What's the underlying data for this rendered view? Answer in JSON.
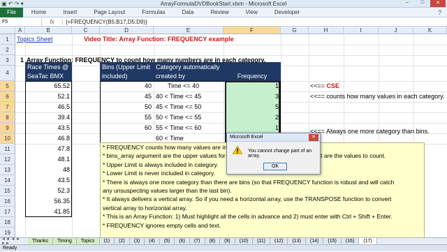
{
  "window": {
    "title": "ArrayFormulaDVDBookStart.xlsm - Microsoft Excel",
    "min": "–",
    "max": "□",
    "close": "✕"
  },
  "ribbon": {
    "file": "File",
    "tabs": [
      "Home",
      "Insert",
      "Page Layout",
      "Formulas",
      "Data",
      "Review",
      "View",
      "Developer"
    ],
    "help": "?"
  },
  "formula_bar": {
    "name_box": "F5",
    "fx": "fx",
    "formula": "{=FREQUENCY(B5:B17,D5:D9)}"
  },
  "columns": [
    "A",
    "B",
    "C",
    "D",
    "E",
    "F",
    "G",
    "H",
    "I",
    "J",
    "K"
  ],
  "rows": [
    "1",
    "2",
    "3",
    "4",
    "5",
    "6",
    "7",
    "8",
    "9",
    "10",
    "11",
    "12",
    "13",
    "14",
    "15",
    "16",
    "17",
    "18",
    "19",
    "20",
    "21",
    "22"
  ],
  "sheet": {
    "link": "Topics Sheet",
    "video_title": "Video Title: Array Function: FREQUENCY example",
    "row3_num": "1",
    "row3_text": "Array Function: FREQUENCY to count how many numbers are in each category.",
    "race_header": [
      "Race Times @",
      "SeaTac BMX"
    ],
    "race_times": [
      "65.52",
      "52.1",
      "46.5",
      "39.4",
      "43.5",
      "46.8",
      "47.8",
      "48.1",
      "48",
      "43.5",
      "52.3",
      "56.35",
      "41.85"
    ],
    "bins_header": [
      "Bins (Upper Limit",
      "included)"
    ],
    "bins": [
      "40",
      "45",
      "50",
      "55",
      "60"
    ],
    "cat_header": [
      "Category automatically",
      "created by FREQUENCY"
    ],
    "categories": [
      "Time <= 40",
      "40 < Time <= 45",
      "45 < Time <= 50",
      "50 < Time <= 55",
      "55 < Time <= 60",
      "60 < Time"
    ],
    "freq_header": "Frequency",
    "frequency": [
      "1",
      "3",
      "5",
      "2",
      "1",
      "1"
    ],
    "note_cse_arrow": "<<==",
    "note_cse": "CSE",
    "note_counts": "<<== counts how many values in each category.",
    "note_always": "<<== Always one more category than bins."
  },
  "notes": [
    "* FREQUENCY counts how many values are in each category.",
    "* bins_array argument are the upper values for each category, data_array argument are the values to count.",
    "* Upper Limit is always included in category.",
    "* Lower Limit is never included in category.",
    "* There is always one more category than there are bins (so that FREQUENCY function is robust and will catch",
    "   any unsuspecting values larger than the last bin).",
    "* It always delivers a vertical array. So if you need a horizontal array, use the TRANSPOSE function to convert",
    "   vertical array to horizontal array.",
    "* This is an Array Function: 1) Must highlight all the cells in advance and 2) must enter with Ctrl + Shift + Enter.",
    "* FREQUENCY ignores empty cells and text."
  ],
  "dialog": {
    "title": "Microsoft Excel",
    "message": "You cannot change part of an array.",
    "ok": "OK",
    "close": "✕"
  },
  "sheet_tabs": {
    "nav": "◄◄ ◄ ► ►►",
    "tabs": [
      "Thanks",
      "Timing",
      "Topics",
      "(1)",
      "(2)",
      "(3)",
      "(4)",
      "(5)",
      "(6)",
      "(7)",
      "(8)",
      "(9)",
      "(10)",
      "(11)",
      "(12)",
      "(13)",
      "(14)",
      "(15)",
      "(16)",
      "(17)"
    ]
  },
  "status": "Ready"
}
